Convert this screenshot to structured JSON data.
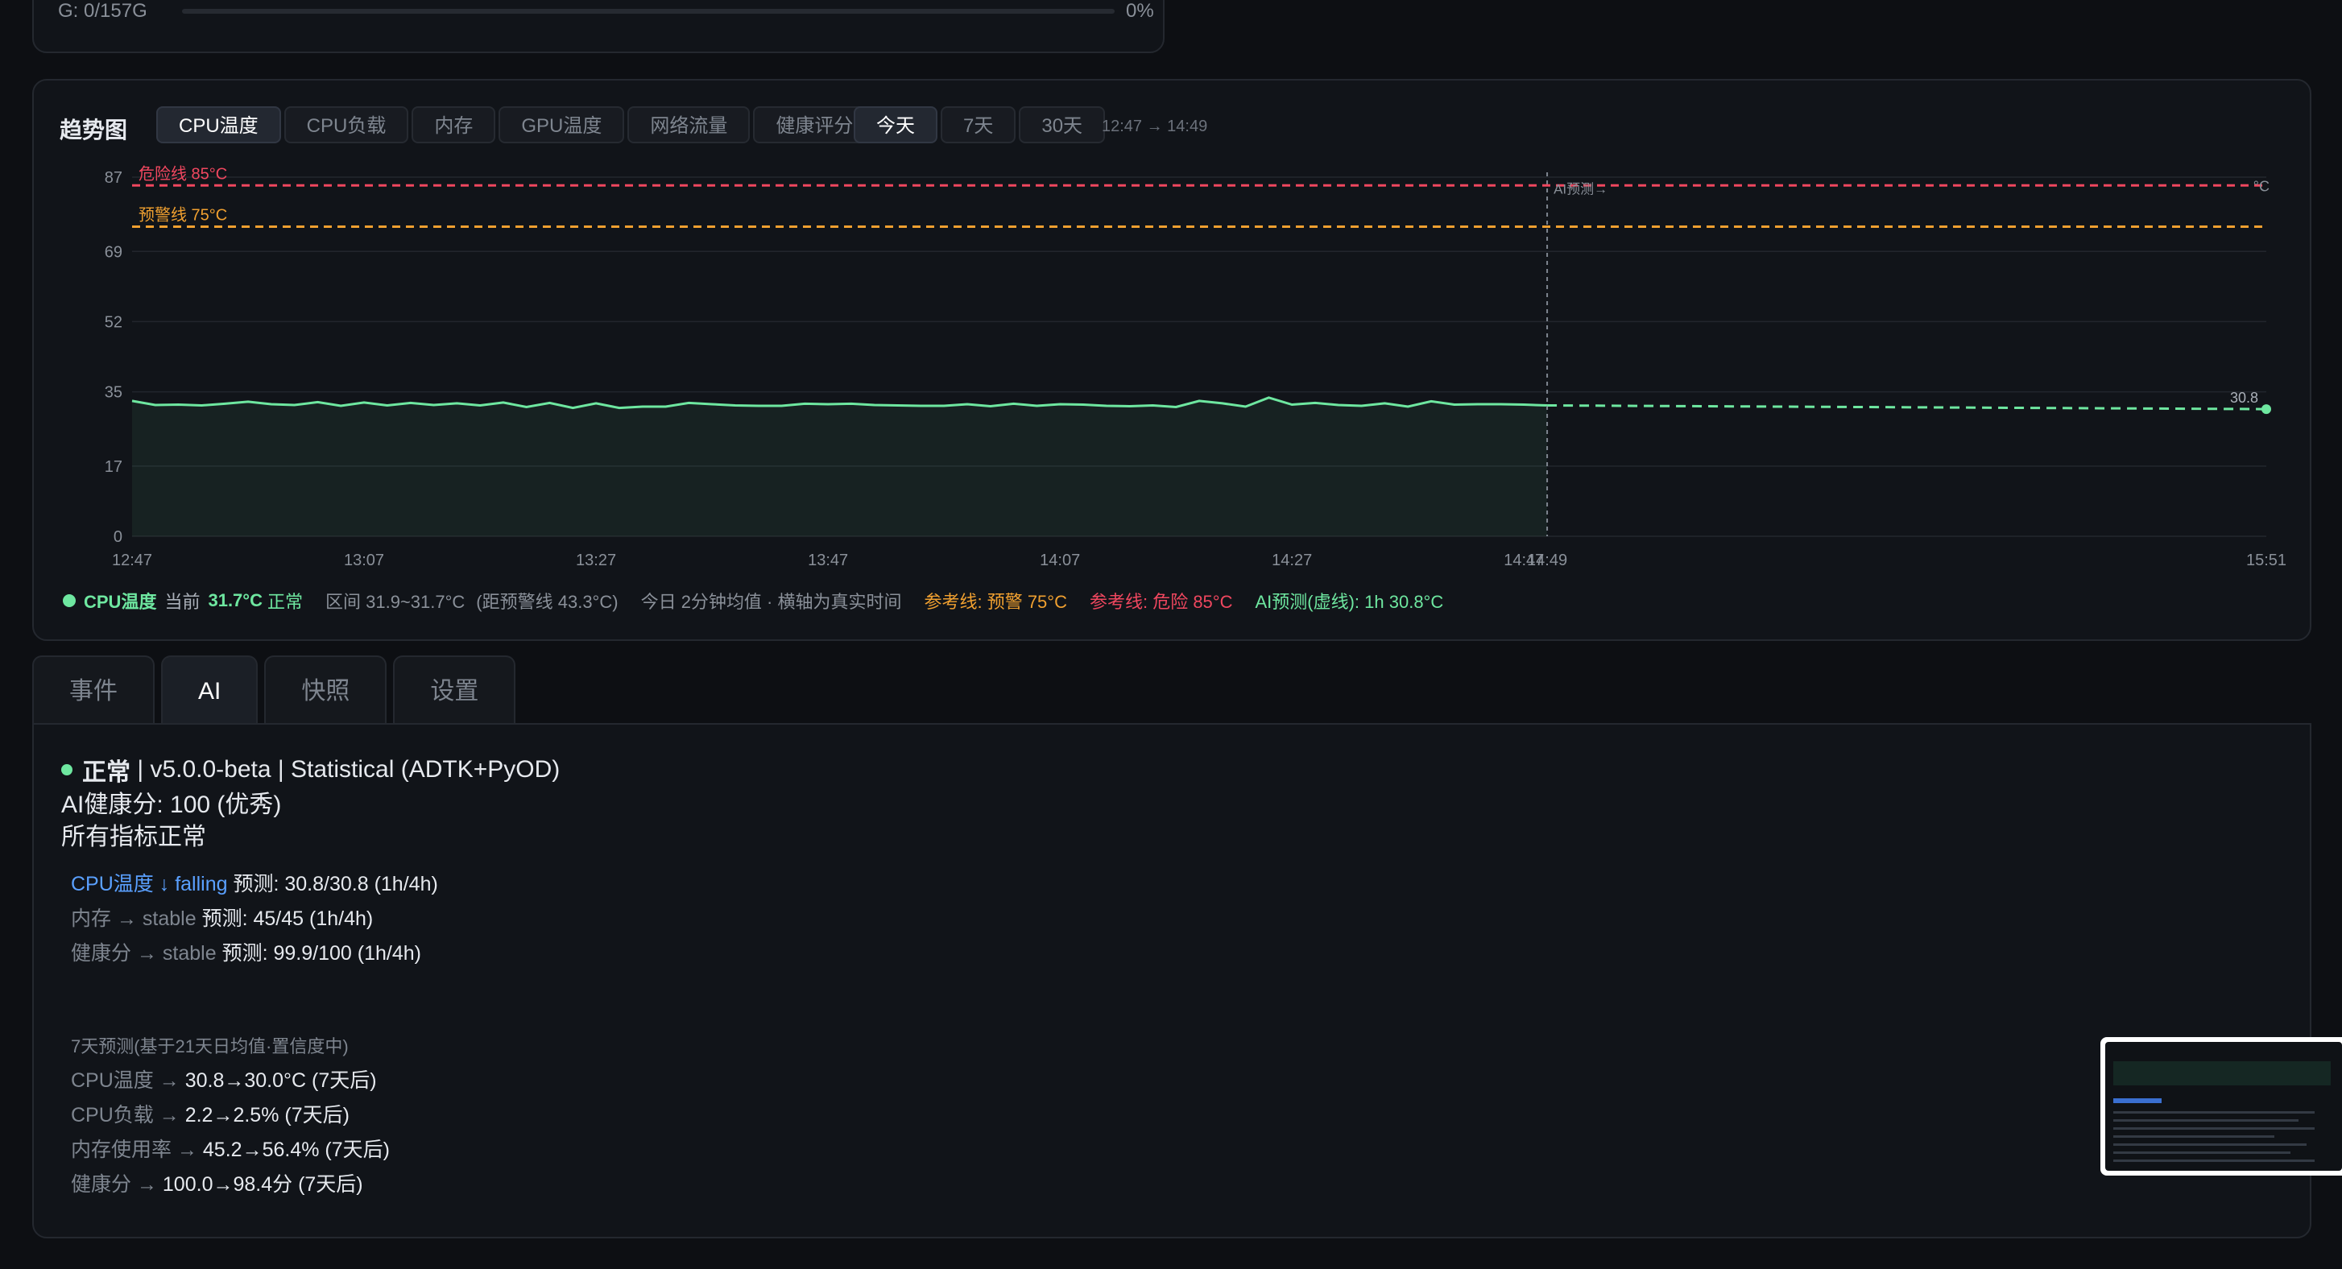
{
  "top_card": {
    "label": "G: 0/157G",
    "percent": "0%"
  },
  "trend": {
    "title": "趋势图",
    "metric_tabs": [
      "CPU温度",
      "CPU负载",
      "内存",
      "GPU温度",
      "网络流量",
      "健康评分"
    ],
    "active_metric": "CPU温度",
    "range_tabs": [
      "今天",
      "7天",
      "30天"
    ],
    "active_range": "今天",
    "range_text": "12:47 → 14:49",
    "legend": {
      "metric": "CPU温度",
      "current_prefix": "当前",
      "current_value": "31.7°C",
      "status": "正常",
      "interval": "区间 31.9~31.7°C",
      "distance": "(距预警线 43.3°C)",
      "note": "今日 2分钟均值 · 横轴为真实时间",
      "ref_warn": "参考线: 预警 75°C",
      "ref_danger": "参考线: 危险 85°C",
      "ai_forecast": "AI预测(虚线): 1h 30.8°C"
    }
  },
  "chart_data": {
    "type": "line",
    "title": "",
    "xlabel": "",
    "ylabel": "",
    "unit": "°C",
    "y_ticks": [
      0,
      17,
      35,
      52,
      69,
      87
    ],
    "ylim": [
      0,
      87
    ],
    "x_ticks": [
      "12:47",
      "13:07",
      "13:27",
      "13:47",
      "14:07",
      "14:27",
      "14:47",
      "14:49",
      "15:51"
    ],
    "x_start": "12:47",
    "x_end": "15:51",
    "history_end": "14:49",
    "series": [
      {
        "name": "CPU温度",
        "color": "#6ee7a0",
        "x": [
          "12:47",
          "12:49",
          "12:51",
          "12:53",
          "12:55",
          "12:57",
          "12:59",
          "13:01",
          "13:03",
          "13:05",
          "13:07",
          "13:09",
          "13:11",
          "13:13",
          "13:15",
          "13:17",
          "13:19",
          "13:21",
          "13:23",
          "13:25",
          "13:27",
          "13:29",
          "13:31",
          "13:33",
          "13:35",
          "13:37",
          "13:39",
          "13:41",
          "13:43",
          "13:45",
          "13:47",
          "13:49",
          "13:51",
          "13:53",
          "13:55",
          "13:57",
          "13:59",
          "14:01",
          "14:03",
          "14:05",
          "14:07",
          "14:09",
          "14:11",
          "14:13",
          "14:15",
          "14:17",
          "14:19",
          "14:21",
          "14:23",
          "14:25",
          "14:27",
          "14:29",
          "14:31",
          "14:33",
          "14:35",
          "14:37",
          "14:39",
          "14:41",
          "14:43",
          "14:45",
          "14:47",
          "14:49"
        ],
        "values": [
          32.8,
          31.8,
          31.9,
          31.7,
          32.1,
          32.6,
          32.0,
          31.8,
          32.5,
          31.6,
          32.4,
          31.7,
          32.3,
          31.8,
          32.2,
          31.7,
          32.4,
          31.3,
          32.3,
          31.1,
          32.2,
          31.1,
          31.4,
          31.4,
          32.3,
          32.0,
          31.7,
          31.6,
          31.6,
          32.1,
          32.0,
          32.1,
          31.8,
          31.7,
          31.6,
          31.6,
          32.0,
          31.5,
          32.1,
          31.6,
          32.0,
          31.9,
          31.6,
          31.5,
          31.7,
          31.3,
          32.8,
          32.2,
          31.4,
          33.6,
          31.9,
          32.3,
          31.8,
          31.6,
          32.2,
          31.4,
          32.7,
          31.9,
          32.0,
          32.0,
          31.9,
          31.7
        ]
      },
      {
        "name": "AI预测",
        "color": "#6ee7a0",
        "dashed": true,
        "x": [
          "14:49",
          "15:51"
        ],
        "values": [
          31.7,
          30.8
        ]
      }
    ],
    "reference_lines": [
      {
        "label": "危险线 85°C",
        "value": 85,
        "color": "#f0475f"
      },
      {
        "label": "预警线 75°C",
        "value": 75,
        "color": "#f0a030"
      }
    ],
    "annotations": {
      "forecast_label": "AI预测→",
      "end_value": "30.8",
      "end_unit": "°C"
    },
    "grid": true,
    "area_fill": true
  },
  "bottom_tabs": [
    "事件",
    "AI",
    "快照",
    "设置"
  ],
  "active_bottom_tab": "AI",
  "ai": {
    "status": "正常",
    "status_rest": " | v5.0.0-beta | Statistical (ADTK+PyOD)",
    "health": "AI健康分: 100 (优秀)",
    "summary": "所有指标正常",
    "trends": [
      {
        "metric": "CPU温度",
        "arrow": "↓",
        "trend": "falling",
        "forecast": "预测: 30.8/30.8 (1h/4h)",
        "highlight": true
      },
      {
        "metric": "内存",
        "arrow": "→",
        "trend": "stable",
        "forecast": "预测: 45/45 (1h/4h)",
        "highlight": false
      },
      {
        "metric": "健康分",
        "arrow": "→",
        "trend": "stable",
        "forecast": "预测: 99.9/100 (1h/4h)",
        "highlight": false
      }
    ],
    "forecast7_title": "7天预测(基于21天日均值·置信度中)",
    "forecast7": [
      {
        "metric": "CPU温度 →",
        "value": "30.8→30.0°C (7天后)"
      },
      {
        "metric": "CPU负载 →",
        "value": "2.2→2.5% (7天后)"
      },
      {
        "metric": "内存使用率 →",
        "value": "45.2→56.4% (7天后)"
      },
      {
        "metric": "健康分 →",
        "value": "100.0→98.4分 (7天后)"
      }
    ]
  }
}
